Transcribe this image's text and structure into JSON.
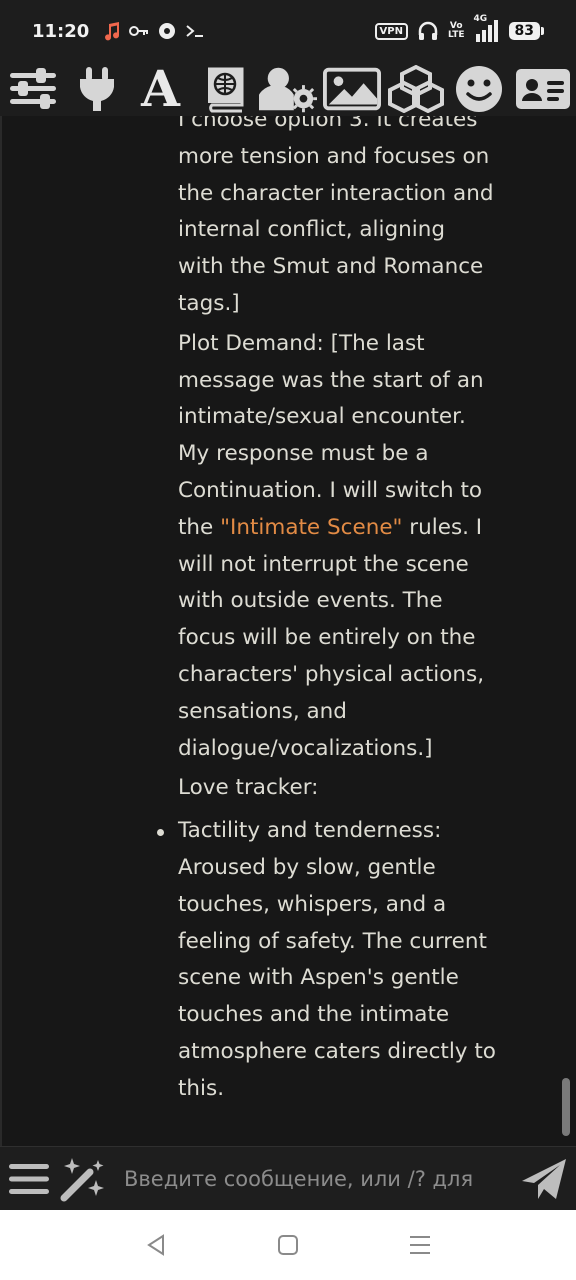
{
  "status_bar": {
    "time": "11:20",
    "left_icons": [
      "music-note-icon",
      "key-icon",
      "emblem-icon",
      "terminal-icon"
    ],
    "vpn_label": "VPN",
    "volte_label_top": "Vo",
    "volte_label_bottom": "LTE",
    "network_label": "4G",
    "battery_level": "83"
  },
  "toolbar": {
    "items": [
      {
        "name": "sliders-icon"
      },
      {
        "name": "plug-icon"
      },
      {
        "name": "font-icon",
        "label": "A"
      },
      {
        "name": "world-book-icon"
      },
      {
        "name": "user-settings-icon"
      },
      {
        "name": "image-icon"
      },
      {
        "name": "extensions-icon"
      },
      {
        "name": "smiley-icon"
      },
      {
        "name": "id-card-icon"
      }
    ]
  },
  "message": {
    "clipped_top_line": "I choose option 3. It",
    "para1_rest": "creates more tension and focuses on the character interaction and internal conflict, aligning with the Smut and Romance tags.]",
    "para2_before": "Plot Demand: [The last message was the start of an intimate/sexual encounter. My response must be a Continuation. I will switch to the ",
    "para2_highlight": "\"Intimate Scene\"",
    "para2_after": " rules. I will not interrupt the scene with outside events. The focus will be entirely on the characters' physical actions, sensations, and dialogue/vocalizations.]",
    "love_tracker_label": "Love tracker:",
    "bullet1": "Tactility and tenderness: Aroused by slow, gentle touches, whispers, and a feeling of safety. The current scene with Aspen's gentle touches and the intimate atmosphere caters directly to this."
  },
  "input_bar": {
    "placeholder": "Введите сообщение, или /? для"
  },
  "colors": {
    "background": "#171717",
    "text": "#dddcd3",
    "highlight": "#e28b45",
    "toolbar_icon": "#d6d6d6"
  }
}
